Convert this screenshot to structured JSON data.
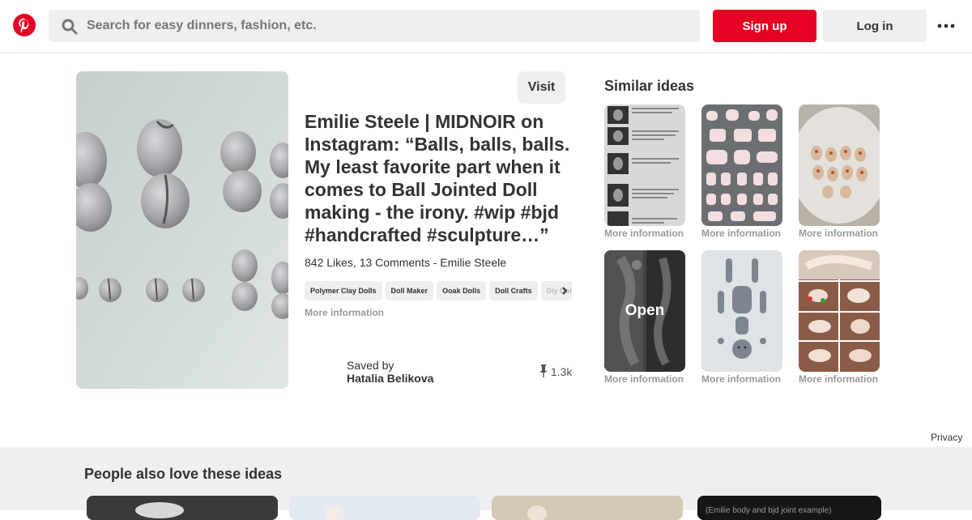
{
  "header": {
    "search_placeholder": "Search for easy dinners, fashion, etc.",
    "signup_label": "Sign up",
    "login_label": "Log in",
    "brand_color": "#e60023"
  },
  "pin": {
    "visit_label": "Visit",
    "title": "Emilie Steele | MIDNOIR on Instagram: “Balls, balls, balls. My least favorite part when it comes to Ball Jointed Doll making - the irony. #wip #bjd #handcrafted #sculpture…”",
    "meta": "842 Likes, 13 Comments - Emilie Steele",
    "tags": [
      "Polymer Clay Dolls",
      "Doll Maker",
      "Ooak Dolls",
      "Doll Crafts",
      "Diy Dolls"
    ],
    "more_info": "More information",
    "saved_by_label": "Saved by",
    "saved_by_name": "Hatalia Belikova",
    "repin_count": "1.3k"
  },
  "similar": {
    "title": "Similar ideas",
    "items": [
      {
        "more_info": "More information"
      },
      {
        "more_info": "More information"
      },
      {
        "more_info": "More information"
      },
      {
        "more_info": "More information",
        "overlay": "Open"
      },
      {
        "more_info": "More information"
      },
      {
        "more_info": "More information"
      }
    ]
  },
  "privacy_label": "Privacy",
  "people_also_love": {
    "title": "People also love these ideas",
    "card4_caption": "(Emilie body and bjd joint example)"
  }
}
